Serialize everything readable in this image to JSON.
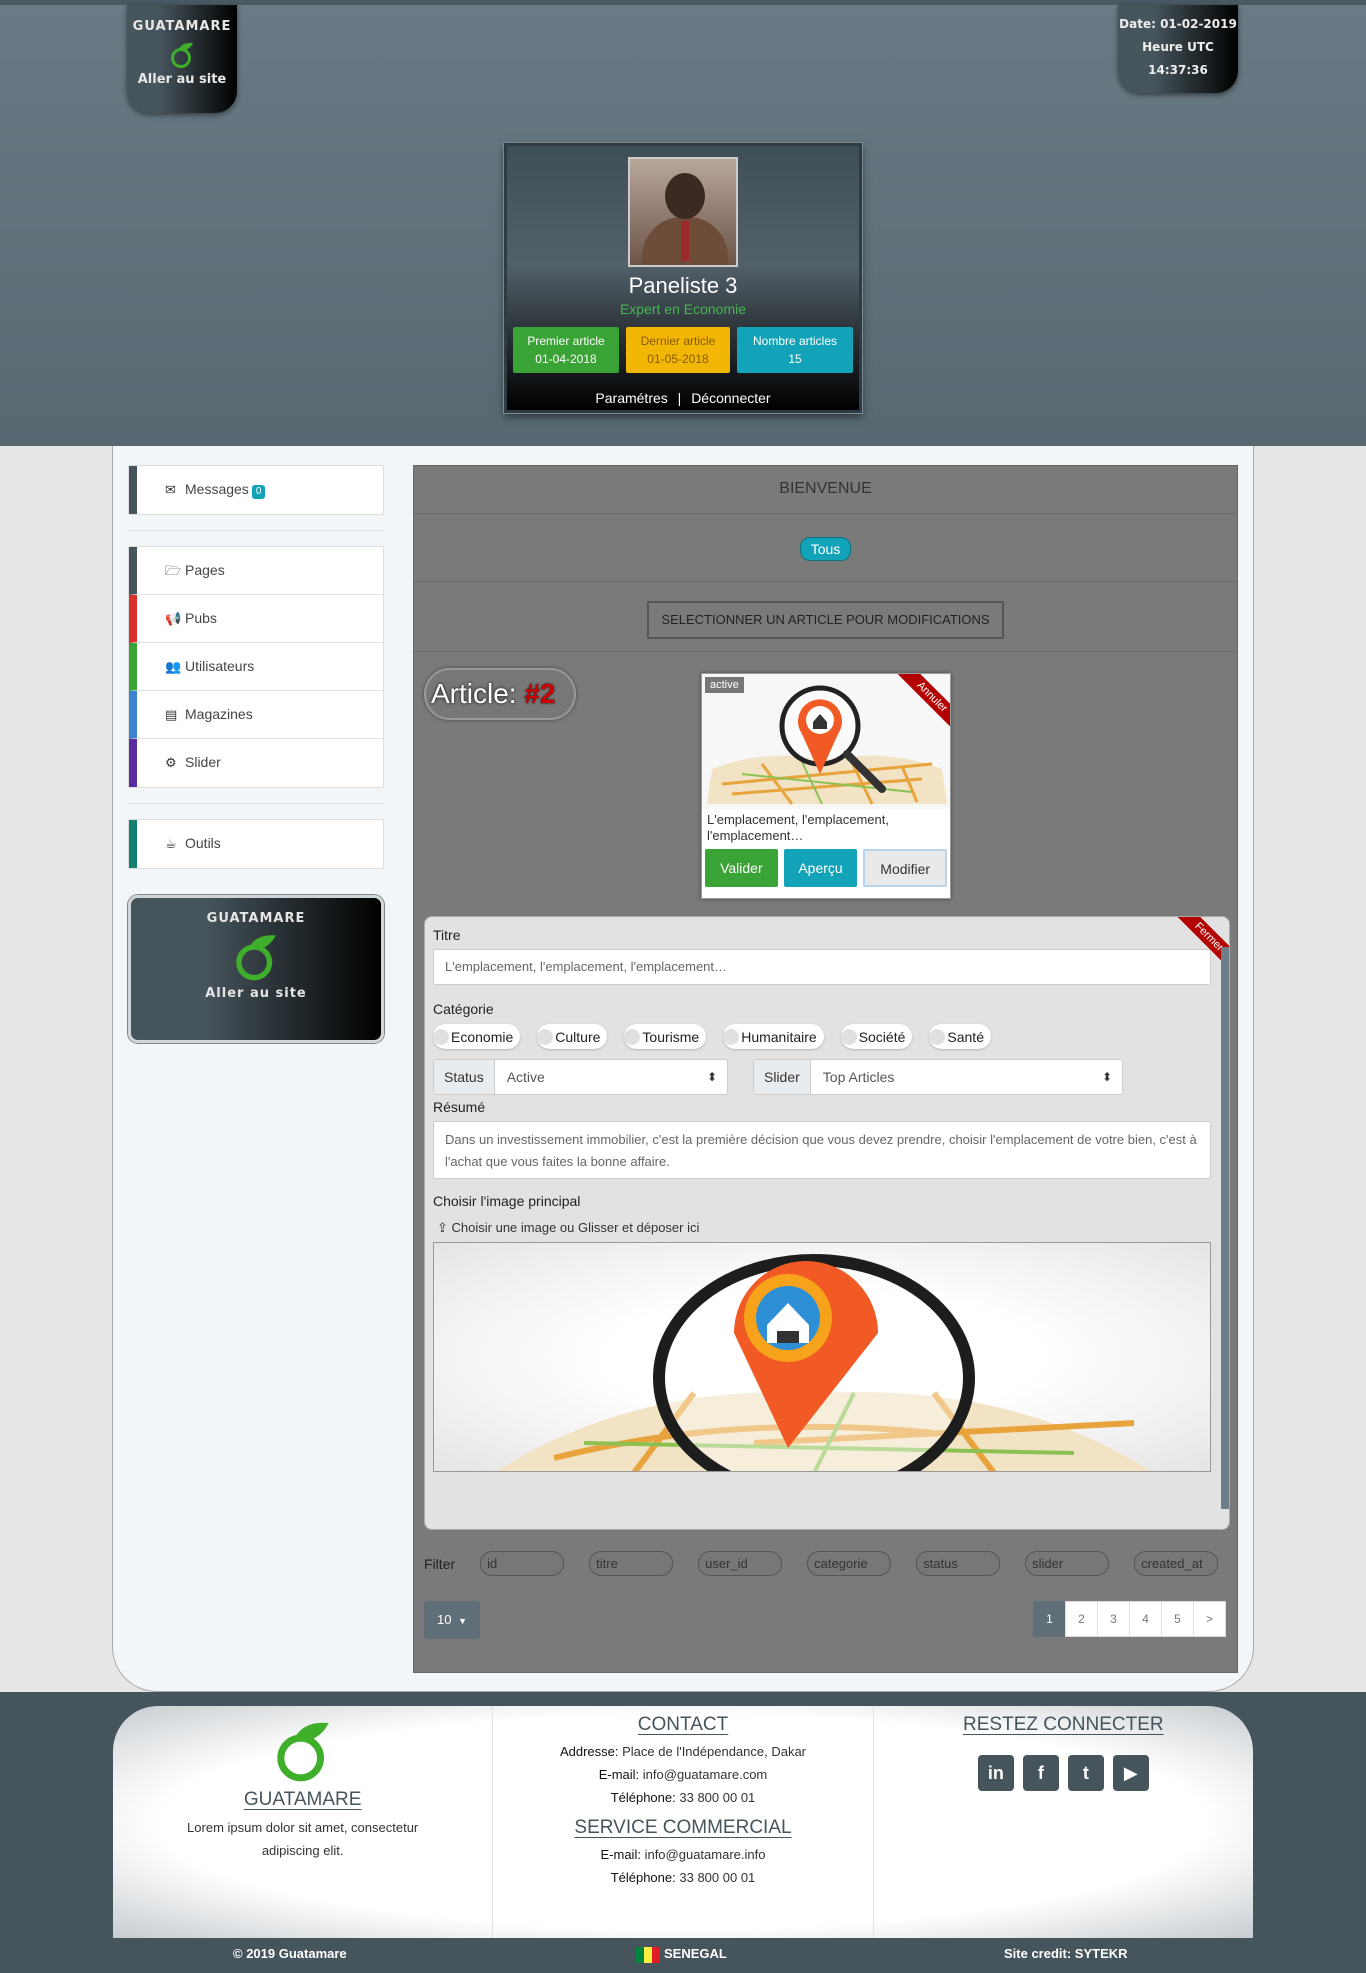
{
  "brand": {
    "name": "GUATAMARE",
    "link": "Aller au site"
  },
  "datetime": {
    "date": "Date: 01-02-2019",
    "tz": "Heure UTC",
    "time": "14:37:36"
  },
  "profile": {
    "name": "Paneliste 3",
    "role": "Expert en Economie",
    "stats": [
      {
        "label": "Premier article",
        "value": "01-04-2018"
      },
      {
        "label": "Dernier article",
        "value": "01-05-2018"
      },
      {
        "label": "Nombre articles",
        "value": "15"
      }
    ],
    "links": {
      "settings": "Paramétres",
      "sep": "|",
      "logout": "Déconnecter"
    }
  },
  "sidebar": {
    "messages": {
      "label": "Messages",
      "count": "0"
    },
    "items": [
      {
        "label": "Pages",
        "color": "#46545c",
        "icon": "folder-open-icon"
      },
      {
        "label": "Pubs",
        "color": "#d9312b",
        "icon": "bullhorn-icon"
      },
      {
        "label": "Utilisateurs",
        "color": "#3aa335",
        "icon": "users-icon"
      },
      {
        "label": "Magazines",
        "color": "#3b82d1",
        "icon": "newspaper-icon"
      },
      {
        "label": "Slider",
        "color": "#5a2ca0",
        "icon": "gears-icon"
      }
    ],
    "tools": {
      "label": "Outils",
      "color": "#12806e"
    }
  },
  "content": {
    "welcome": "BIENVENUE",
    "filter_all": "Tous",
    "select_button": "SELECTIONNER UN ARTICLE POUR MODIFICATIONS",
    "article_label": "Article:",
    "article_number": "#2"
  },
  "article_card": {
    "status": "active",
    "ribbon": "Annuler",
    "text": "L'emplacement, l'emplacement, l'emplacement…",
    "buttons": {
      "valider": "Valider",
      "apercu": "Aperçu",
      "modifier": "Modifier"
    }
  },
  "form": {
    "ribbon": "Fermer",
    "title_label": "Titre",
    "title_value": "L'emplacement, l'emplacement, l'emplacement…",
    "category_label": "Catégorie",
    "categories": [
      "Economie",
      "Culture",
      "Tourisme",
      "Humanitaire",
      "Société",
      "Santé"
    ],
    "status_label": "Status",
    "status_value": "Active",
    "slider_label": "Slider",
    "slider_value": "Top Articles",
    "summary_label": "Résumé",
    "summary_value": "Dans un investissement immobilier, c'est la première décision que vous devez prendre, choisir l'emplacement de votre bien, c'est à l'achat que vous faites la bonne affaire.",
    "image_label": "Choisir l'image principal",
    "upload_label": "Choisir une image ou Glisser et déposer ici"
  },
  "table": {
    "filter_label": "Filter",
    "filters": [
      "id",
      "titre",
      "user_id",
      "categorie",
      "status",
      "slider",
      "created_at"
    ],
    "page_size": "10",
    "pages": [
      "1",
      "2",
      "3",
      "4",
      "5",
      ">"
    ]
  },
  "footer": {
    "about": {
      "title": "GUATAMARE",
      "text": "Lorem ipsum dolor sit amet, consectetur adipiscing elit."
    },
    "contact": {
      "title": "CONTACT",
      "address_label": "Addresse:",
      "address": "Place de l'Indépendance, Dakar",
      "email_label": "E-mail:",
      "email": "info@guatamare.com",
      "phone_label": "Téléphone:",
      "phone": "33 800 00 01"
    },
    "commercial": {
      "title": "SERVICE COMMERCIAL",
      "email_label": "E-mail:",
      "email": "info@guatamare.info",
      "phone_label": "Téléphone:",
      "phone": "33 800 00 01"
    },
    "social": {
      "title": "RESTEZ CONNECTER",
      "icons": [
        "linkedin-icon",
        "facebook-icon",
        "twitter-icon",
        "youtube-icon"
      ]
    },
    "copyright": "© 2019 Guatamare",
    "country": "SENEGAL",
    "credit": "Site credit: SYTEKR"
  }
}
